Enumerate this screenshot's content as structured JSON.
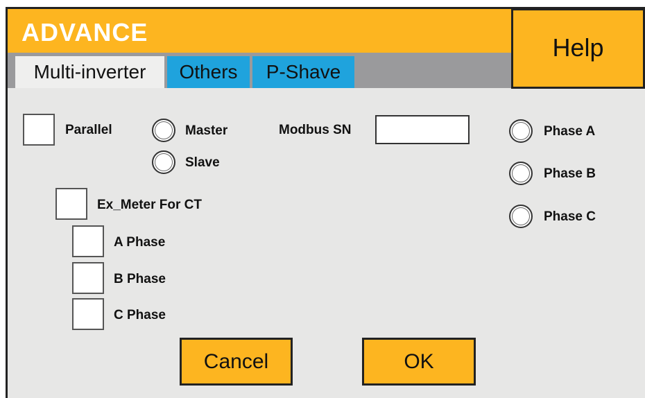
{
  "window": {
    "title": "ADVANCE",
    "help_label": "Help"
  },
  "tabs": [
    {
      "label": "Multi-inverter",
      "active": true
    },
    {
      "label": "Others",
      "active": false
    },
    {
      "label": "P-Shave",
      "active": false
    }
  ],
  "form": {
    "parallel": {
      "label": "Parallel",
      "checked": false
    },
    "master": {
      "label": "Master",
      "selected": false
    },
    "slave": {
      "label": "Slave",
      "selected": false
    },
    "modbus_sn": {
      "label": "Modbus SN",
      "value": ""
    },
    "ex_meter": {
      "label": "Ex_Meter For CT",
      "checked": false
    },
    "a_phase": {
      "label": "A Phase",
      "checked": false
    },
    "b_phase": {
      "label": "B Phase",
      "checked": false
    },
    "c_phase": {
      "label": "C Phase",
      "checked": false
    },
    "phase_a": {
      "label": "Phase A",
      "selected": false
    },
    "phase_b": {
      "label": "Phase B",
      "selected": false
    },
    "phase_c": {
      "label": "Phase C",
      "selected": false
    }
  },
  "buttons": {
    "cancel": "Cancel",
    "ok": "OK"
  },
  "colors": {
    "accent": "#fdb520",
    "tab_blue": "#1fa3dd",
    "tab_strip": "#9a9a9c",
    "panel": "#e7e7e6"
  }
}
